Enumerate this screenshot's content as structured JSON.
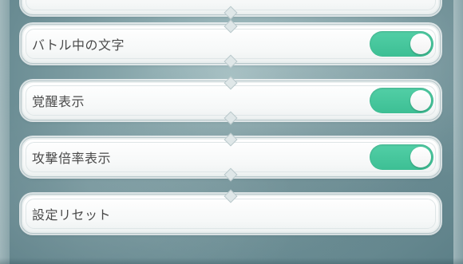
{
  "settings": {
    "items": [
      {
        "label": "",
        "type": "partial-row"
      },
      {
        "label": "バトル中の文字",
        "type": "toggle",
        "state": "on"
      },
      {
        "label": "覚醒表示",
        "type": "toggle",
        "state": "on"
      },
      {
        "label": "攻撃倍率表示",
        "type": "toggle",
        "state": "on"
      },
      {
        "label": "設定リセット",
        "type": "button"
      }
    ]
  },
  "colors": {
    "toggle_on": "#3dbf94",
    "row_background": "#ffffff",
    "label_text": "#4a4a4a",
    "page_background": "#86a5aa"
  }
}
